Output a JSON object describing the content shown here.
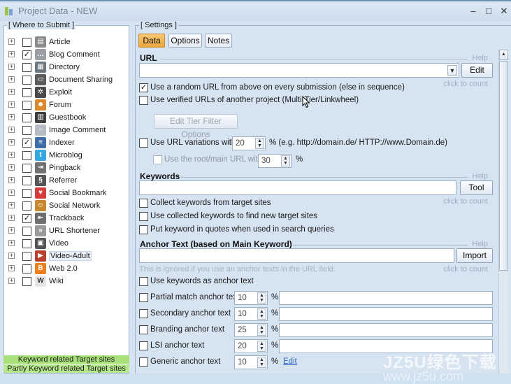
{
  "window": {
    "title": "Project Data - NEW",
    "min": "–",
    "max": "□",
    "close": "✕"
  },
  "left_panel": {
    "legend": "[ Where to Submit ]",
    "items": [
      {
        "label": "Article",
        "checked": false,
        "icon": "article-icon",
        "color": "#8a8a8a",
        "glyph": "▤"
      },
      {
        "label": "Blog Comment",
        "checked": true,
        "icon": "blog-comment-icon",
        "color": "#9aa0a6",
        "glyph": "…"
      },
      {
        "label": "Directory",
        "checked": false,
        "icon": "directory-icon",
        "color": "#6c7780",
        "glyph": "▦"
      },
      {
        "label": "Document Sharing",
        "checked": false,
        "icon": "document-sharing-icon",
        "color": "#5b5b5b",
        "glyph": "▭"
      },
      {
        "label": "Exploit",
        "checked": false,
        "icon": "exploit-icon",
        "color": "#4a4a4a",
        "glyph": "✲"
      },
      {
        "label": "Forum",
        "checked": false,
        "icon": "forum-icon",
        "color": "#d88a2a",
        "glyph": "☻"
      },
      {
        "label": "Guestbook",
        "checked": false,
        "icon": "guestbook-icon",
        "color": "#3d3d3d",
        "glyph": "▥"
      },
      {
        "label": "Image Comment",
        "checked": false,
        "icon": "image-comment-icon",
        "color": "#b5bcc3",
        "glyph": "▫"
      },
      {
        "label": "Indexer",
        "checked": true,
        "icon": "indexer-icon",
        "color": "#3d6ea8",
        "glyph": "≡"
      },
      {
        "label": "Microblog",
        "checked": false,
        "icon": "microblog-icon",
        "color": "#35a8e0",
        "glyph": "t"
      },
      {
        "label": "Pingback",
        "checked": false,
        "icon": "pingback-icon",
        "color": "#707070",
        "glyph": "⇥"
      },
      {
        "label": "Referrer",
        "checked": false,
        "icon": "referrer-icon",
        "color": "#555555",
        "glyph": "§"
      },
      {
        "label": "Social Bookmark",
        "checked": false,
        "icon": "social-bookmark-icon",
        "color": "#d63a3a",
        "glyph": "♥"
      },
      {
        "label": "Social Network",
        "checked": false,
        "icon": "social-network-icon",
        "color": "#c8892c",
        "glyph": "☺"
      },
      {
        "label": "Trackback",
        "checked": true,
        "icon": "trackback-icon",
        "color": "#6e6e6e",
        "glyph": "⇤"
      },
      {
        "label": "URL Shortener",
        "checked": false,
        "icon": "url-shortener-icon",
        "color": "#9a9a9a",
        "glyph": "»"
      },
      {
        "label": "Video",
        "checked": false,
        "icon": "video-icon",
        "color": "#555555",
        "glyph": "▣"
      },
      {
        "label": "Video-Adult",
        "checked": false,
        "icon": "video-adult-icon",
        "color": "#b8402c",
        "glyph": "▶"
      },
      {
        "label": "Web 2.0",
        "checked": false,
        "icon": "web20-icon",
        "color": "#ef7f1a",
        "glyph": "B"
      },
      {
        "label": "Wiki",
        "checked": false,
        "icon": "wiki-icon",
        "color": "#e6e6e6",
        "glyph": "W"
      }
    ],
    "selected_index": 17,
    "bottom_bars": [
      "Keyword related Target sites",
      "Partly Keyword related Target sites"
    ]
  },
  "settings": {
    "legend": "[ Settings ]",
    "tabs": [
      {
        "label": "Data",
        "active": true
      },
      {
        "label": "Options",
        "active": false
      },
      {
        "label": "Notes",
        "active": false
      }
    ],
    "help": "Help",
    "click_to_count": "click to count",
    "url": {
      "title": "URL",
      "input_value": "",
      "edit_button": "Edit",
      "random_url": {
        "label": "Use a random URL from above on every submission (else in sequence)",
        "checked": true
      },
      "verified_urls": {
        "label": "Use verified URLs of another project (Multi-Tier/Linkwheel)",
        "checked": false
      },
      "edit_tier_button": "Edit Tier Filter Options",
      "variations": {
        "label": "Use URL variations with",
        "checked": false,
        "value": "20",
        "suffix": "% (e.g. http://domain.de/ HTTP://www.Domain.de)"
      },
      "root_url": {
        "label": "Use the root/main URL with",
        "checked": false,
        "value": "30",
        "suffix": "%"
      }
    },
    "keywords": {
      "title": "Keywords",
      "input_value": "",
      "tool_button": "Tool",
      "options": [
        {
          "label": "Collect keywords from target sites",
          "checked": false
        },
        {
          "label": "Use collected keywords to find new target sites",
          "checked": false
        },
        {
          "label": "Put keyword in quotes when used in search queries",
          "checked": false
        }
      ]
    },
    "anchor": {
      "title": "Anchor Text (based on Main Keyword)",
      "input_value": "",
      "import_button": "Import",
      "note": "This is ignored if you use an anchor texts in the URL field.",
      "use_keywords": {
        "label": "Use keywords as anchor text",
        "checked": false
      },
      "rows": [
        {
          "label": "Partial match anchor text",
          "value": "10",
          "text": ""
        },
        {
          "label": "Secondary anchor text",
          "value": "10",
          "text": ""
        },
        {
          "label": "Branding anchor text",
          "value": "25",
          "text": ""
        },
        {
          "label": "LSI anchor text",
          "value": "20",
          "text": ""
        },
        {
          "label": "Generic anchor text",
          "value": "10",
          "link": "Edit"
        }
      ],
      "pct": "%"
    }
  },
  "watermark": {
    "brand": "JZ5U绿色下载",
    "url": "www.jz5u.com"
  }
}
